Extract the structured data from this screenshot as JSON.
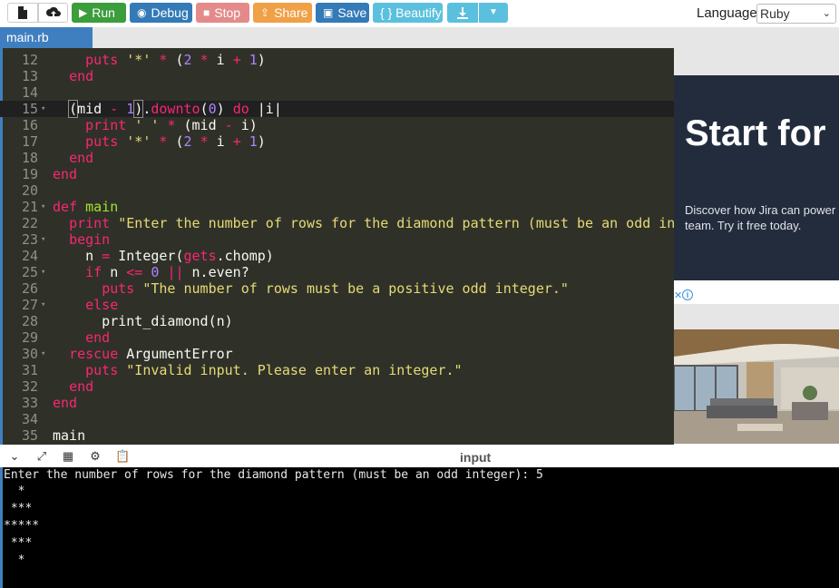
{
  "toolbar": {
    "new_icon": "file-icon",
    "upload_icon": "cloud-upload-icon",
    "run": "Run",
    "debug": "Debug",
    "stop": "Stop",
    "share": "Share",
    "save": "Save",
    "beautify": "{ } Beautify",
    "download_icon": "download-icon",
    "language_label": "Language",
    "language_value": "Ruby"
  },
  "tabs": [
    {
      "label": "main.rb"
    }
  ],
  "editor": {
    "active_line": 15,
    "lines": [
      {
        "n": "12",
        "fold": false,
        "tokens": [
          [
            "    ",
            "ident"
          ],
          [
            "puts",
            "kw"
          ],
          [
            " ",
            "ident"
          ],
          [
            "'*'",
            "str"
          ],
          [
            " ",
            "ident"
          ],
          [
            "*",
            "op"
          ],
          [
            " (",
            "punct"
          ],
          [
            "2",
            "num"
          ],
          [
            " ",
            "ident"
          ],
          [
            "*",
            "op"
          ],
          [
            " i ",
            "ident"
          ],
          [
            "+",
            "op"
          ],
          [
            " ",
            "ident"
          ],
          [
            "1",
            "num"
          ],
          [
            ")",
            "punct"
          ]
        ]
      },
      {
        "n": "13",
        "fold": false,
        "tokens": [
          [
            "  ",
            "ident"
          ],
          [
            "end",
            "kw"
          ]
        ]
      },
      {
        "n": "14",
        "fold": false,
        "tokens": []
      },
      {
        "n": "15",
        "fold": true,
        "tokens": [
          [
            "  ",
            "ident"
          ],
          [
            "(",
            "bracket"
          ],
          [
            "mid ",
            "ident"
          ],
          [
            "-",
            "op"
          ],
          [
            " ",
            "ident"
          ],
          [
            "1",
            "num"
          ],
          [
            ")",
            "bracket"
          ],
          [
            ".",
            "punct"
          ],
          [
            "downto",
            "kw"
          ],
          [
            "(",
            "punct"
          ],
          [
            "0",
            "num"
          ],
          [
            ") ",
            "punct"
          ],
          [
            "do",
            "kw"
          ],
          [
            " |i|",
            "ident"
          ]
        ]
      },
      {
        "n": "16",
        "fold": false,
        "tokens": [
          [
            "    ",
            "ident"
          ],
          [
            "print",
            "kw"
          ],
          [
            " ",
            "ident"
          ],
          [
            "' '",
            "str"
          ],
          [
            " ",
            "ident"
          ],
          [
            "*",
            "op"
          ],
          [
            " (mid ",
            "ident"
          ],
          [
            "-",
            "op"
          ],
          [
            " i)",
            "ident"
          ]
        ]
      },
      {
        "n": "17",
        "fold": false,
        "tokens": [
          [
            "    ",
            "ident"
          ],
          [
            "puts",
            "kw"
          ],
          [
            " ",
            "ident"
          ],
          [
            "'*'",
            "str"
          ],
          [
            " ",
            "ident"
          ],
          [
            "*",
            "op"
          ],
          [
            " (",
            "punct"
          ],
          [
            "2",
            "num"
          ],
          [
            " ",
            "ident"
          ],
          [
            "*",
            "op"
          ],
          [
            " i ",
            "ident"
          ],
          [
            "+",
            "op"
          ],
          [
            " ",
            "ident"
          ],
          [
            "1",
            "num"
          ],
          [
            ")",
            "punct"
          ]
        ]
      },
      {
        "n": "18",
        "fold": false,
        "tokens": [
          [
            "  ",
            "ident"
          ],
          [
            "end",
            "kw"
          ]
        ]
      },
      {
        "n": "19",
        "fold": false,
        "tokens": [
          [
            "end",
            "kw"
          ]
        ]
      },
      {
        "n": "20",
        "fold": false,
        "tokens": []
      },
      {
        "n": "21",
        "fold": true,
        "tokens": [
          [
            "def",
            "kw"
          ],
          [
            " ",
            "ident"
          ],
          [
            "main",
            "fn"
          ]
        ]
      },
      {
        "n": "22",
        "fold": false,
        "tokens": [
          [
            "  ",
            "ident"
          ],
          [
            "print",
            "kw"
          ],
          [
            " ",
            "ident"
          ],
          [
            "\"Enter the number of rows for the diamond pattern (must be an odd integer): \"",
            "str"
          ]
        ]
      },
      {
        "n": "23",
        "fold": true,
        "tokens": [
          [
            "  ",
            "ident"
          ],
          [
            "begin",
            "kw"
          ]
        ]
      },
      {
        "n": "24",
        "fold": false,
        "tokens": [
          [
            "    n ",
            "ident"
          ],
          [
            "=",
            "op"
          ],
          [
            " Integer(",
            "ident"
          ],
          [
            "gets",
            "kw"
          ],
          [
            ".chomp)",
            "ident"
          ]
        ]
      },
      {
        "n": "25",
        "fold": true,
        "tokens": [
          [
            "    ",
            "ident"
          ],
          [
            "if",
            "kw"
          ],
          [
            " n ",
            "ident"
          ],
          [
            "<=",
            "op"
          ],
          [
            " ",
            "ident"
          ],
          [
            "0",
            "num"
          ],
          [
            " ",
            "ident"
          ],
          [
            "||",
            "op"
          ],
          [
            " n.even?",
            "ident"
          ]
        ]
      },
      {
        "n": "26",
        "fold": false,
        "tokens": [
          [
            "      ",
            "ident"
          ],
          [
            "puts",
            "kw"
          ],
          [
            " ",
            "ident"
          ],
          [
            "\"The number of rows must be a positive odd integer.\"",
            "str"
          ]
        ]
      },
      {
        "n": "27",
        "fold": true,
        "tokens": [
          [
            "    ",
            "ident"
          ],
          [
            "else",
            "kw"
          ]
        ]
      },
      {
        "n": "28",
        "fold": false,
        "tokens": [
          [
            "      print_diamond(n)",
            "ident"
          ]
        ]
      },
      {
        "n": "29",
        "fold": false,
        "tokens": [
          [
            "    ",
            "ident"
          ],
          [
            "end",
            "kw"
          ]
        ]
      },
      {
        "n": "30",
        "fold": true,
        "tokens": [
          [
            "  ",
            "ident"
          ],
          [
            "rescue",
            "kw"
          ],
          [
            " ArgumentError",
            "ident"
          ]
        ]
      },
      {
        "n": "31",
        "fold": false,
        "tokens": [
          [
            "    ",
            "ident"
          ],
          [
            "puts",
            "kw"
          ],
          [
            " ",
            "ident"
          ],
          [
            "\"Invalid input. Please enter an integer.\"",
            "str"
          ]
        ]
      },
      {
        "n": "32",
        "fold": false,
        "tokens": [
          [
            "  ",
            "ident"
          ],
          [
            "end",
            "kw"
          ]
        ]
      },
      {
        "n": "33",
        "fold": false,
        "tokens": [
          [
            "end",
            "kw"
          ]
        ]
      },
      {
        "n": "34",
        "fold": false,
        "tokens": []
      },
      {
        "n": "35",
        "fold": false,
        "tokens": [
          [
            "main",
            "ident"
          ]
        ]
      }
    ]
  },
  "ad": {
    "headline": "Start for",
    "description_line1": "Discover how Jira can power",
    "description_line2": "team. Try it free today.",
    "close_glyph": "✕",
    "info_glyph": "i"
  },
  "io": {
    "title": "input",
    "icons": [
      "chevron-down-icon",
      "expand-icon",
      "layout-icon",
      "gear-icon",
      "paste-icon"
    ],
    "output_lines": [
      "Enter the number of rows for the diamond pattern (must be an odd integer): 5",
      "  *",
      " ***",
      "*****",
      " ***",
      "  *"
    ]
  },
  "colors": {
    "accent": "#3f7fbf",
    "run": "#3c9d3c",
    "debug": "#337ab7",
    "stop": "#e48a8a",
    "share": "#f0a046",
    "beautify": "#5bc0de",
    "editor_bg": "#2f3129"
  }
}
